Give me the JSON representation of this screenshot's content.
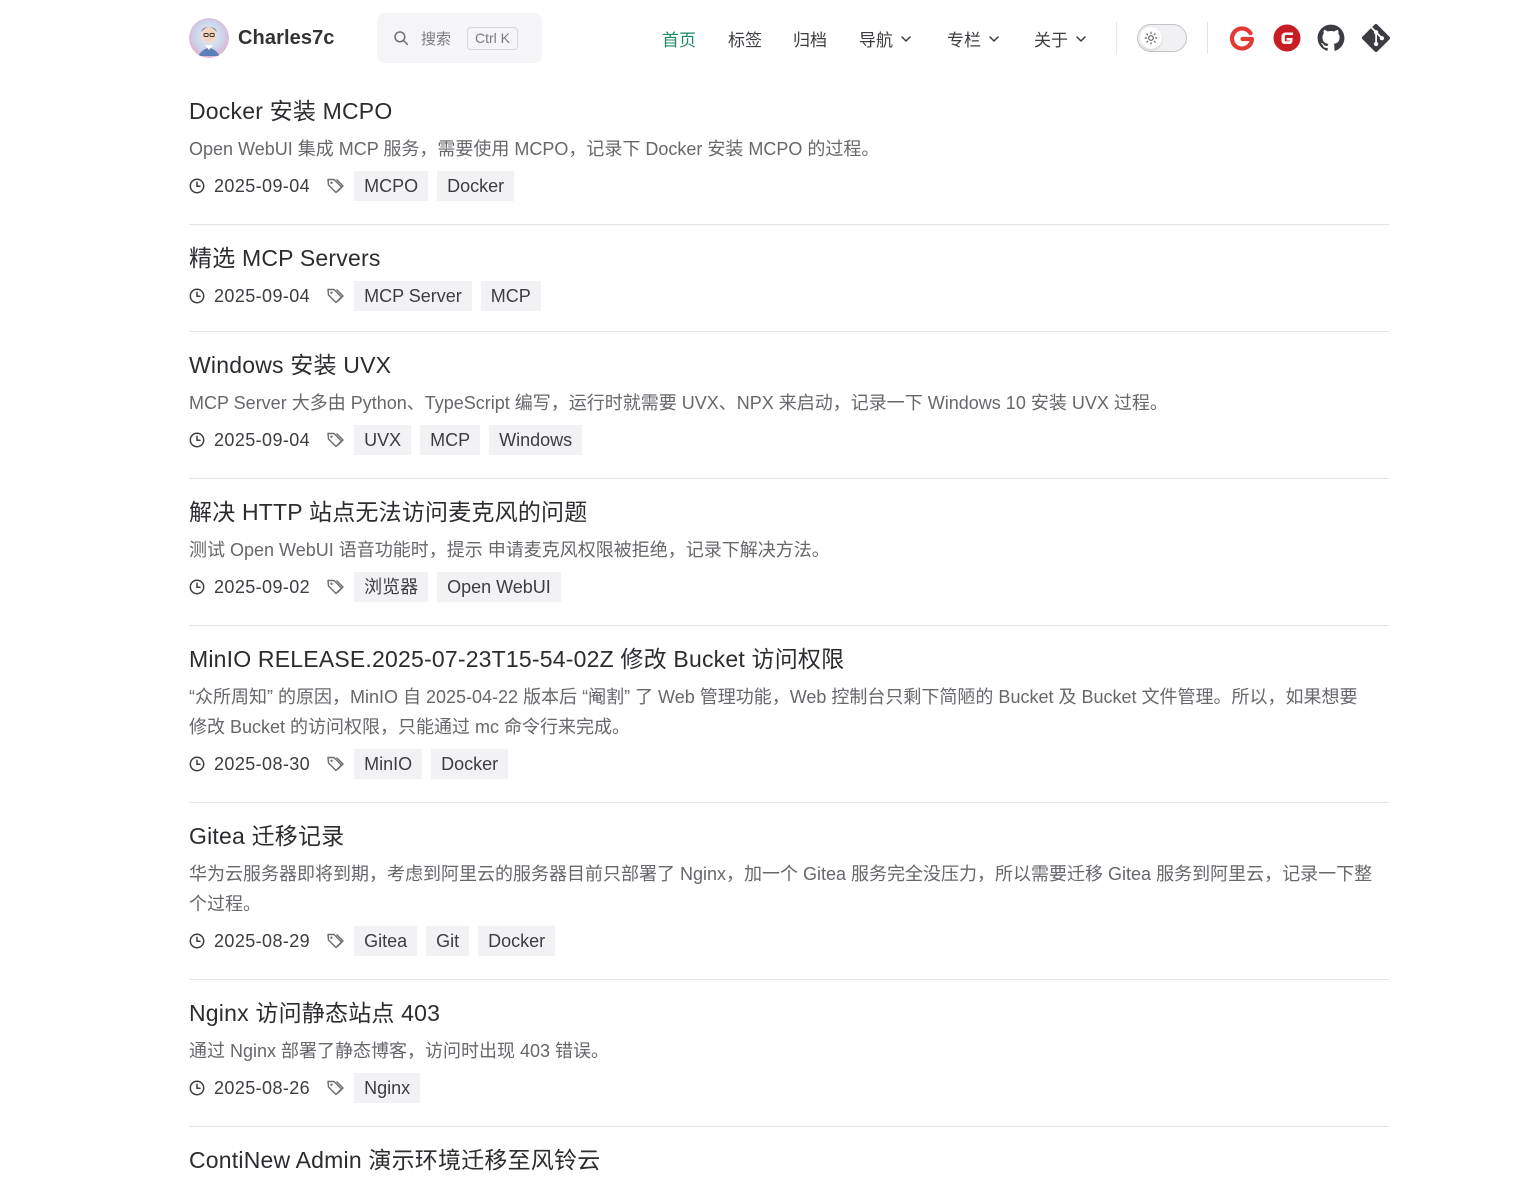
{
  "header": {
    "brand": "Charles7c",
    "search": {
      "placeholder": "搜索",
      "shortcut": "Ctrl K"
    },
    "nav": [
      {
        "label": "首页",
        "active": true,
        "dropdown": false
      },
      {
        "label": "标签",
        "active": false,
        "dropdown": false
      },
      {
        "label": "归档",
        "active": false,
        "dropdown": false
      },
      {
        "label": "导航",
        "active": false,
        "dropdown": true
      },
      {
        "label": "专栏",
        "active": false,
        "dropdown": true
      },
      {
        "label": "关于",
        "active": false,
        "dropdown": true
      }
    ],
    "theme_toggle": {
      "mode": "light",
      "icon": "sun-icon"
    },
    "social": [
      {
        "icon": "gitee-g-icon",
        "color": "#e53935"
      },
      {
        "icon": "gitee-badge-icon",
        "color": "#c71d23"
      },
      {
        "icon": "github-icon",
        "color": "#3c3c43"
      },
      {
        "icon": "git-icon",
        "color": "#3c3c43"
      }
    ],
    "accent_color": "#1f8a5f"
  },
  "posts": [
    {
      "title": "Docker 安装 MCPO",
      "summary": "Open WebUI 集成 MCP 服务，需要使用 MCPO，记录下 Docker 安装 MCPO 的过程。",
      "date": "2025-09-04",
      "tags": [
        "MCPO",
        "Docker"
      ]
    },
    {
      "title": "精选 MCP Servers",
      "summary": "",
      "date": "2025-09-04",
      "tags": [
        "MCP Server",
        "MCP"
      ]
    },
    {
      "title": "Windows 安装 UVX",
      "summary": "MCP Server 大多由 Python、TypeScript 编写，运行时就需要 UVX、NPX 来启动，记录一下 Windows 10 安装 UVX 过程。",
      "date": "2025-09-04",
      "tags": [
        "UVX",
        "MCP",
        "Windows"
      ]
    },
    {
      "title": "解决 HTTP 站点无法访问麦克风的问题",
      "summary": "测试 Open WebUI 语音功能时，提示 申请麦克风权限被拒绝，记录下解决方法。",
      "date": "2025-09-02",
      "tags": [
        "浏览器",
        "Open WebUI"
      ]
    },
    {
      "title": "MinIO RELEASE.2025-07-23T15-54-02Z 修改 Bucket 访问权限",
      "summary": "“众所周知” 的原因，MinIO 自 2025-04-22 版本后 “阉割” 了 Web 管理功能，Web 控制台只剩下简陋的 Bucket 及 Bucket 文件管理。所以，如果想要修改 Bucket 的访问权限，只能通过 mc 命令行来完成。",
      "date": "2025-08-30",
      "tags": [
        "MinIO",
        "Docker"
      ]
    },
    {
      "title": "Gitea 迁移记录",
      "summary": "华为云服务器即将到期，考虑到阿里云的服务器目前只部署了 Nginx，加一个 Gitea 服务完全没压力，所以需要迁移 Gitea 服务到阿里云，记录一下整个过程。",
      "date": "2025-08-29",
      "tags": [
        "Gitea",
        "Git",
        "Docker"
      ]
    },
    {
      "title": "Nginx 访问静态站点 403",
      "summary": "通过 Nginx 部署了静态博客，访问时出现 403 错误。",
      "date": "2025-08-26",
      "tags": [
        "Nginx"
      ]
    },
    {
      "title": "ContiNew Admin 演示环境迁移至风铃云",
      "summary": "",
      "date": "",
      "tags": []
    }
  ]
}
